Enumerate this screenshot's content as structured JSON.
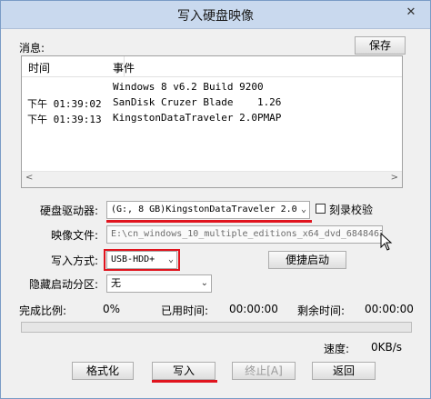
{
  "window": {
    "title": "写入硬盘映像",
    "close_glyph": "✕"
  },
  "messages": {
    "label": "消息:",
    "save_button": "保存",
    "columns": {
      "time": "时间",
      "event": "事件"
    },
    "rows": [
      {
        "time": "",
        "event": "Windows 8 v6.2 Build 9200"
      },
      {
        "time": "下午 01:39:02",
        "event": "SanDisk Cruzer Blade    1.26"
      },
      {
        "time": "下午 01:39:13",
        "event": "KingstonDataTraveler 2.0PMAP"
      }
    ],
    "scroll_left": "<",
    "scroll_right": ">"
  },
  "form": {
    "drive_label": "硬盘驱动器:",
    "drive_value": "(G:, 8 GB)KingstonDataTraveler 2.0",
    "verify_label": "刻录校验",
    "image_label": "映像文件:",
    "image_value": "E:\\cn_windows_10_multiple_editions_x64_dvd_6848463",
    "method_label": "写入方式:",
    "method_value": "USB-HDD+",
    "quick_boot_button": "便捷启动",
    "hidden_label": "隐藏启动分区:",
    "hidden_value": "无"
  },
  "status": {
    "complete_label": "完成比例:",
    "complete_value": "0%",
    "elapsed_label": "已用时间:",
    "elapsed_value": "00:00:00",
    "remaining_label": "剩余时间:",
    "remaining_value": "00:00:00",
    "speed_label": "速度:",
    "speed_value": "0KB/s",
    "progress": 0
  },
  "buttons": {
    "format": "格式化",
    "write": "写入",
    "abort": "终止[A]",
    "back": "返回"
  },
  "colors": {
    "highlight": "#e0141e",
    "titlebar": "#c9d9ee"
  },
  "icons": {
    "dropdown": "chevron-down-icon",
    "close": "close-icon",
    "cursor": "mouse-pointer-icon"
  }
}
